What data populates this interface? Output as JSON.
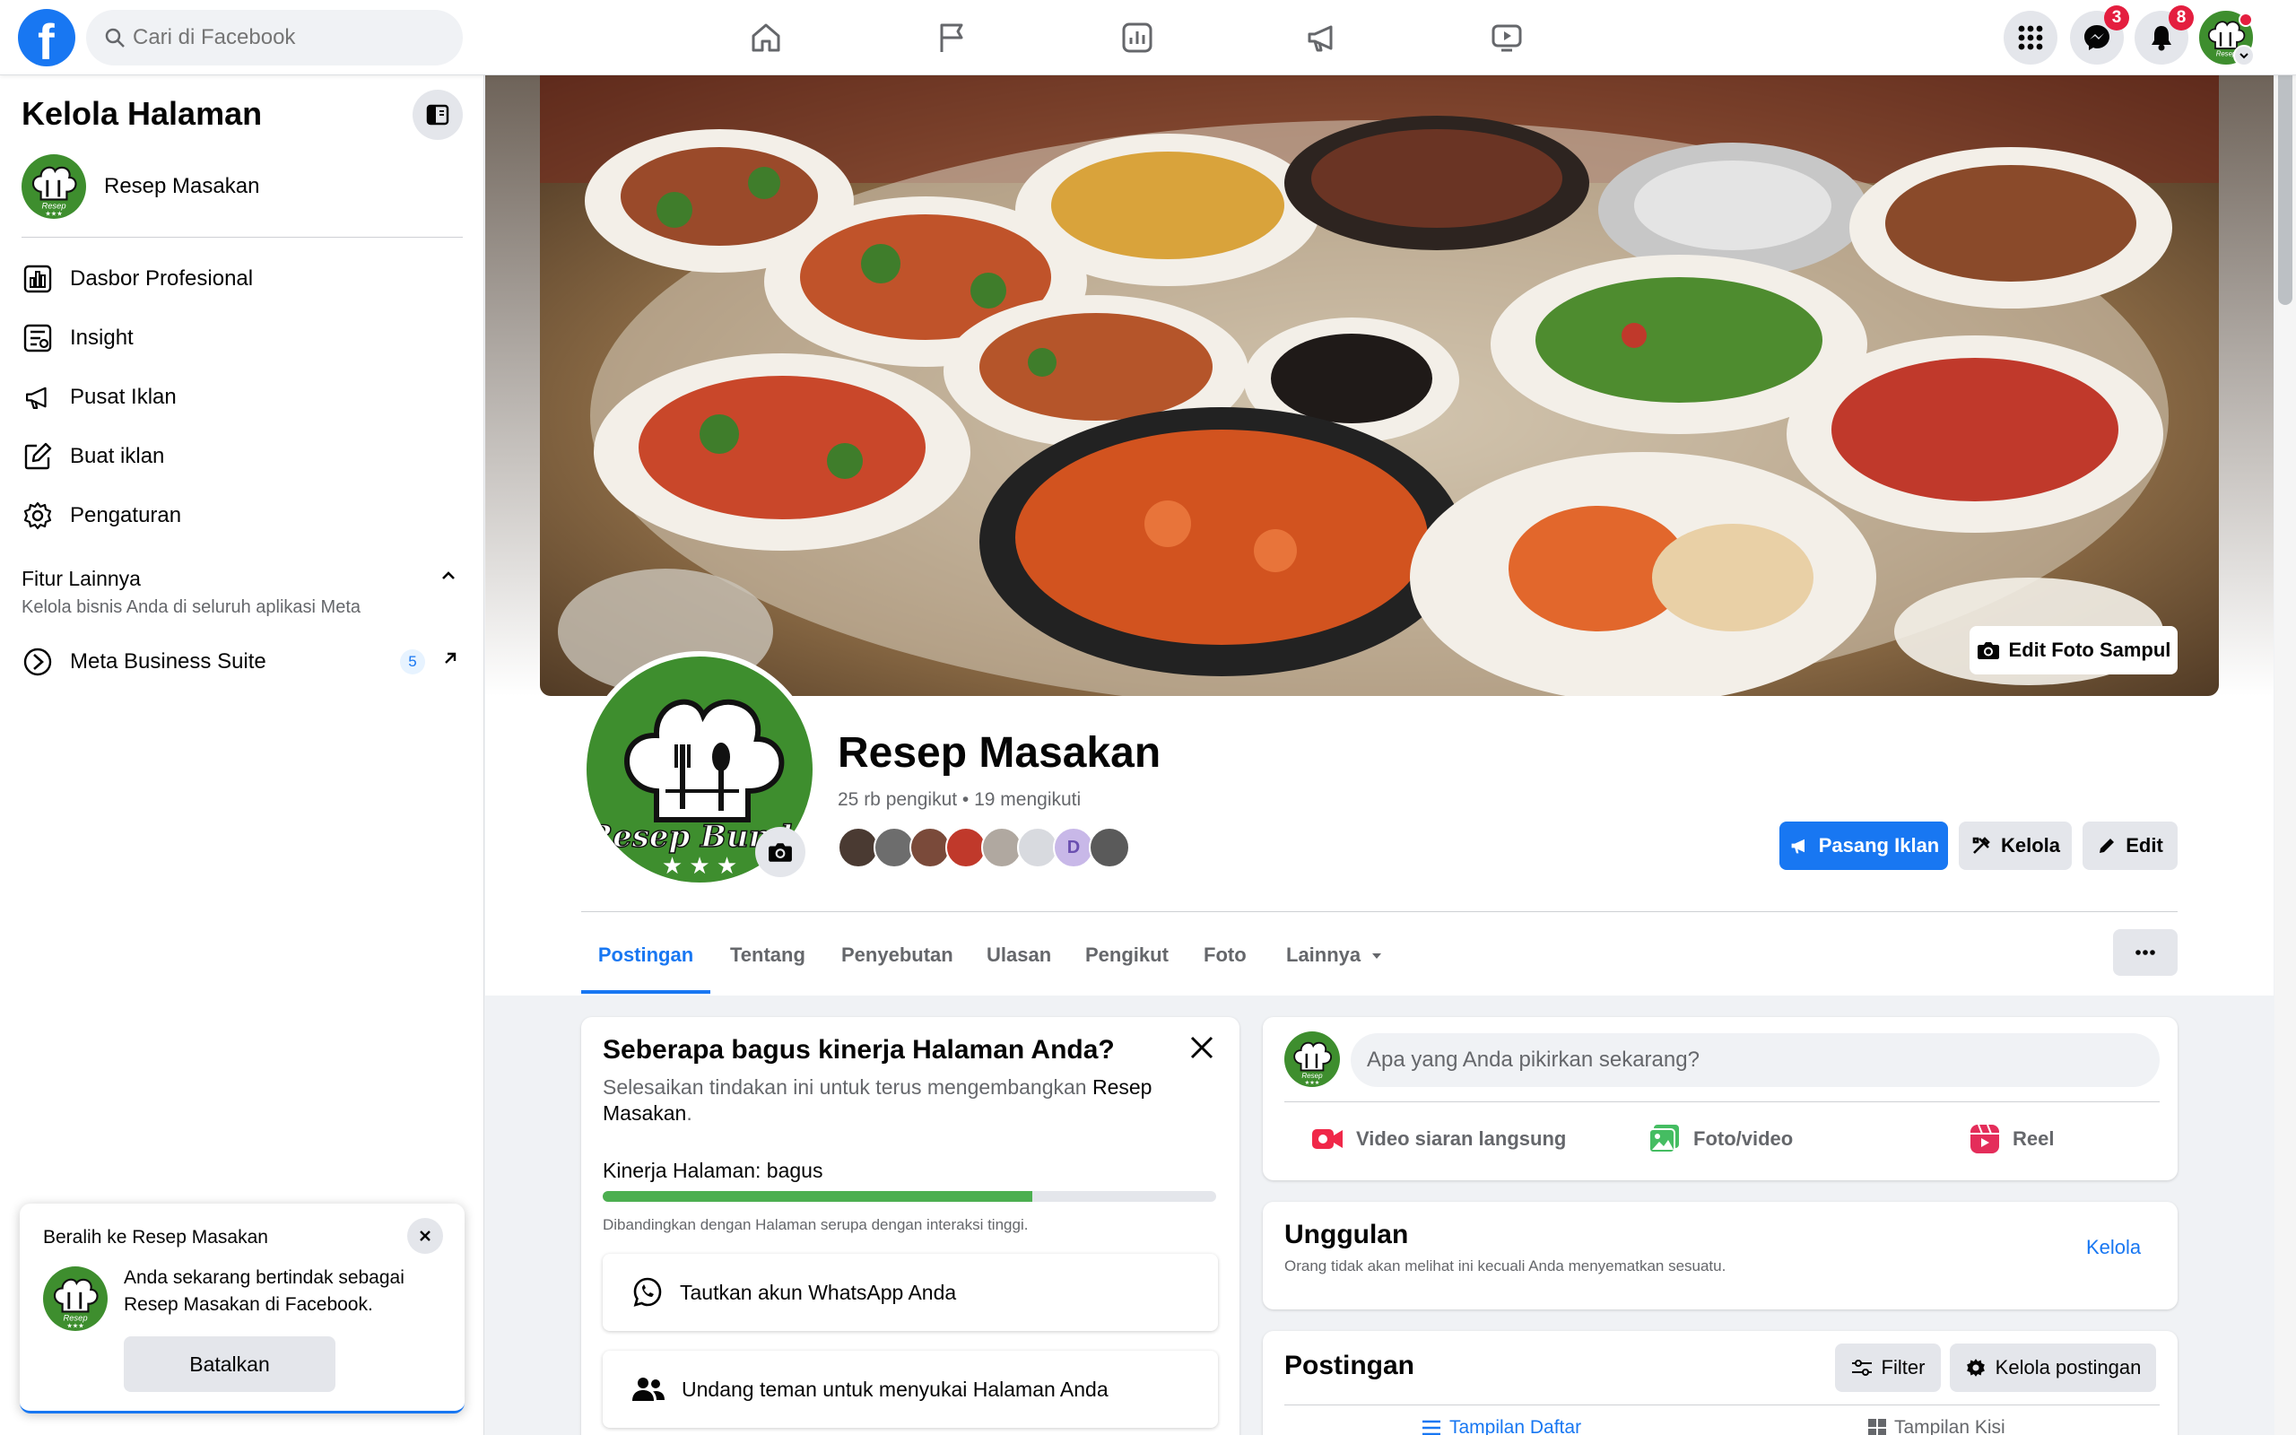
{
  "topbar": {
    "search_placeholder": "Cari di Facebook",
    "messenger_count": "3",
    "notifications_count": "8"
  },
  "sidebar": {
    "title": "Kelola Halaman",
    "page_name": "Resep Masakan",
    "items": [
      {
        "label": "Dasbor Profesional",
        "icon": "dashboard-icon"
      },
      {
        "label": "Insight",
        "icon": "insight-icon"
      },
      {
        "label": "Pusat Iklan",
        "icon": "megaphone-icon"
      },
      {
        "label": "Buat iklan",
        "icon": "edit-icon"
      },
      {
        "label": "Pengaturan",
        "icon": "gear-icon"
      }
    ],
    "more_title": "Fitur Lainnya",
    "more_desc": "Kelola bisnis Anda di seluruh aplikasi Meta",
    "meta_suite_label": "Meta Business Suite",
    "meta_suite_badge": "5"
  },
  "switch_card": {
    "title": "Beralih ke Resep Masakan",
    "text": "Anda sekarang bertindak sebagai Resep Masakan di Facebook.",
    "button": "Batalkan"
  },
  "page": {
    "logo_text": "Resep Bunda",
    "name": "Resep Masakan",
    "stats": "25 rb pengikut • 19 mengikuti",
    "follower_initial": "D",
    "edit_cover": "Edit Foto Sampul",
    "btn_ads": "Pasang Iklan",
    "btn_manage": "Kelola",
    "btn_edit": "Edit"
  },
  "tabs": [
    "Postingan",
    "Tentang",
    "Penyebutan",
    "Ulasan",
    "Pengikut",
    "Foto",
    "Lainnya"
  ],
  "performance": {
    "title": "Seberapa bagus kinerja Halaman Anda?",
    "desc_prefix": "Selesaikan tindakan ini untuk terus mengembangkan ",
    "desc_page": "Resep Masakan",
    "label": "Kinerja Halaman: bagus",
    "progress": 0.7,
    "note": "Dibandingkan dengan Halaman serupa dengan interaksi tinggi.",
    "action1": "Tautkan akun WhatsApp Anda",
    "action2": "Undang teman untuk menyukai Halaman Anda"
  },
  "composer": {
    "placeholder": "Apa yang Anda pikirkan sekarang?",
    "live": "Video siaran langsung",
    "photo": "Foto/video",
    "reel": "Reel"
  },
  "featured": {
    "title": "Unggulan",
    "desc": "Orang tidak akan melihat ini kecuali Anda menyematkan sesuatu.",
    "manage": "Kelola"
  },
  "posts": {
    "title": "Postingan",
    "filter": "Filter",
    "manage": "Kelola postingan",
    "list_view": "Tampilan Daftar",
    "grid_view": "Tampilan Kisi"
  },
  "colors": {
    "brand": "#1877f2",
    "logo_green": "#3e8e2e",
    "progress_green": "#4caf50"
  }
}
